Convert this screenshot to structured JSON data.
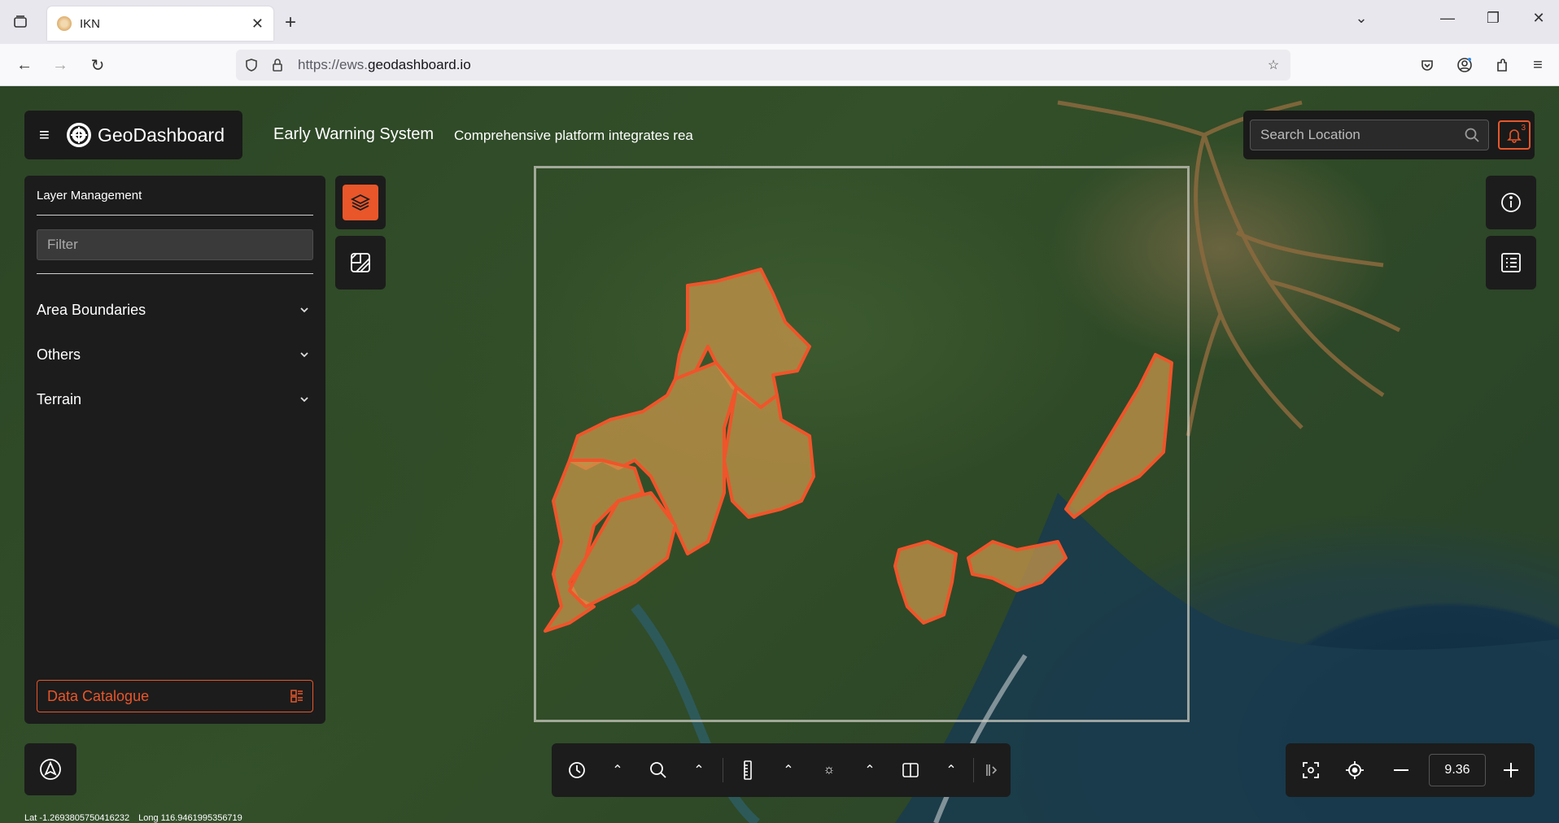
{
  "browser": {
    "tab_title": "IKN",
    "url_prefix": "https://ews.",
    "url_domain": "geodashboard.io"
  },
  "app": {
    "brand": "GeoDashboard",
    "title": "Early Warning System",
    "description": "Comprehensive platform integrates rea",
    "accent": "#e8562a"
  },
  "search": {
    "placeholder": "Search Location",
    "notification_count": "3"
  },
  "layers": {
    "title": "Layer Management",
    "filter_placeholder": "Filter",
    "groups": [
      {
        "label": "Area Boundaries"
      },
      {
        "label": "Others"
      },
      {
        "label": "Terrain"
      }
    ],
    "catalogue_label": "Data Catalogue"
  },
  "zoom": {
    "level": "9.36"
  },
  "coords": {
    "lat": "Lat -1.2693805750416232",
    "long": "Long 116.9461995356719"
  }
}
